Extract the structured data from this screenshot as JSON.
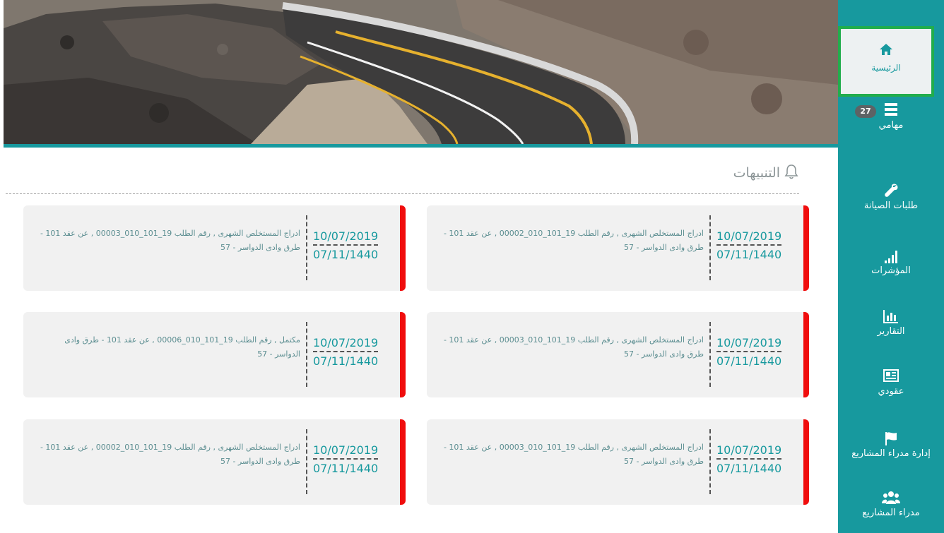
{
  "sidebar": {
    "items": [
      {
        "label": "الرئيسية",
        "icon": "home-icon"
      },
      {
        "label": "مهامي",
        "icon": "tasks-icon",
        "badge": "27"
      },
      {
        "label": "طلبات الصيانة",
        "icon": "wrench-icon"
      },
      {
        "label": "المؤشرات",
        "icon": "signal-bars-icon"
      },
      {
        "label": "التقارير",
        "icon": "bar-chart-icon"
      },
      {
        "label": "عقودي",
        "icon": "contract-icon"
      },
      {
        "label": "إدارة مدراء المشاريع",
        "icon": "flag-icon"
      },
      {
        "label": "مدراء المشاريع",
        "icon": "users-icon"
      }
    ]
  },
  "banner": {
    "image": "mountain-road-photo"
  },
  "notifications": {
    "title": "التنبيهات",
    "cards": [
      {
        "date_gregorian": "10/07/2019",
        "date_hijri": "07/11/1440",
        "message": "ادراج المستخلص الشهرى , رقم الطلب 19_101_010_00002 , عن عقد 101 - طرق وادى الدواسر - 57"
      },
      {
        "date_gregorian": "10/07/2019",
        "date_hijri": "07/11/1440",
        "message": "ادراج المستخلص الشهرى , رقم الطلب 19_101_010_00003 , عن عقد 101 - طرق وادى الدواسر - 57"
      },
      {
        "date_gregorian": "10/07/2019",
        "date_hijri": "07/11/1440",
        "message": "ادراج المستخلص الشهرى , رقم الطلب 19_101_010_00003 , عن عقد 101 - طرق وادى الدواسر - 57"
      },
      {
        "date_gregorian": "10/07/2019",
        "date_hijri": "07/11/1440",
        "message": "مكتمل , رقم الطلب 19_101_010_00006 , عن عقد 101 - طرق وادى الدواسر - 57"
      },
      {
        "date_gregorian": "10/07/2019",
        "date_hijri": "07/11/1440",
        "message": "ادراج المستخلص الشهرى , رقم الطلب 19_101_010_00003 , عن عقد 101 - طرق وادى الدواسر - 57"
      },
      {
        "date_gregorian": "10/07/2019",
        "date_hijri": "07/11/1440",
        "message": "ادراج المستخلص الشهرى , رقم الطلب 19_101_010_00002 , عن عقد 101 - طرق وادى الدواسر - 57"
      }
    ]
  },
  "colors": {
    "primary": "#17999e",
    "alert": "#f00d0d",
    "active_border": "#21ad4c",
    "card_bg": "#f1f1f1"
  }
}
